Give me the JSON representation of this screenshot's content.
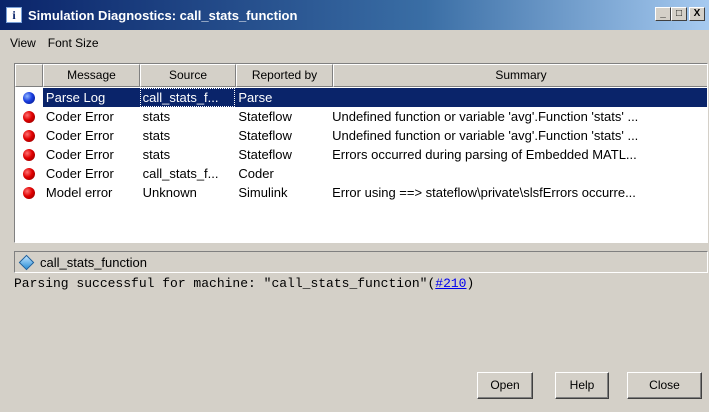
{
  "window": {
    "title": "Simulation Diagnostics: call_stats_function",
    "title_icon": "i",
    "minimize": "_",
    "maximize": "□",
    "close": "X"
  },
  "menu": [
    "View",
    "Font Size"
  ],
  "table": {
    "columns": [
      "Message",
      "Source",
      "Reported by",
      "Summary"
    ],
    "rows": [
      {
        "icon": "blue-ball-icon",
        "message": "Parse Log",
        "source": "call_stats_f...",
        "reported_by": "Parse",
        "summary": ""
      },
      {
        "icon": "red-ball-icon",
        "message": "Coder Error",
        "source": "stats",
        "reported_by": "Stateflow",
        "summary": "Undefined function or variable 'avg'.Function 'stats' ..."
      },
      {
        "icon": "red-ball-icon",
        "message": "Coder Error",
        "source": "stats",
        "reported_by": "Stateflow",
        "summary": "Undefined function or variable 'avg'.Function 'stats' ..."
      },
      {
        "icon": "red-ball-icon",
        "message": "Coder Error",
        "source": "stats",
        "reported_by": "Stateflow",
        "summary": "Errors occurred during parsing of Embedded MATL..."
      },
      {
        "icon": "red-ball-icon",
        "message": "Coder Error",
        "source": "call_stats_f...",
        "reported_by": "Coder",
        "summary": ""
      },
      {
        "icon": "red-ball-icon",
        "message": "Model error",
        "source": "Unknown",
        "reported_by": "Simulink",
        "summary": "Error using ==> stateflow\\private\\slsfErrors occurre..."
      }
    ],
    "selected_row": 0
  },
  "details": {
    "name": "call_stats_function",
    "text_before": "Parsing successful for machine: \"call_stats_function\"(",
    "link": "#210",
    "text_after": ")"
  },
  "buttons": {
    "open": "Open",
    "help": "Help",
    "close": "Close"
  },
  "colors": {
    "selection": "#0a246a",
    "error": "#e00000",
    "info": "#1a3ee0",
    "link": "#0000ee"
  }
}
